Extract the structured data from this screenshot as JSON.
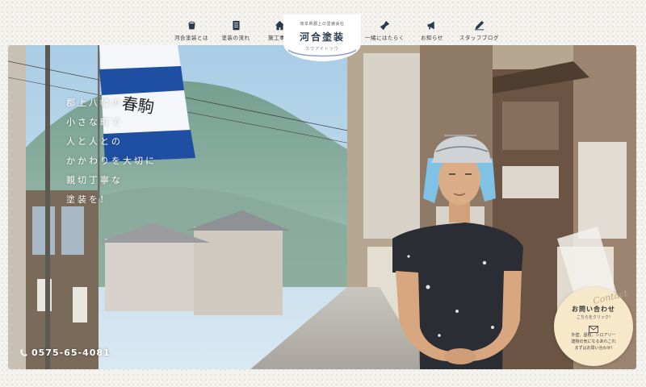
{
  "header": {
    "nav_left": [
      {
        "label": "河合塗装とは",
        "icon": "paint-bucket-icon"
      },
      {
        "label": "塗装の流れ",
        "icon": "document-icon"
      },
      {
        "label": "施工事例",
        "icon": "house-icon"
      }
    ],
    "logo": {
      "sub": "岐阜県郡上の塗装会社",
      "main": "河合塗装",
      "kana": "カワアイトソウ"
    },
    "nav_right": [
      {
        "label": "一緒にはたらく",
        "icon": "paint-brush-icon"
      },
      {
        "label": "お知らせ",
        "icon": "megaphone-icon"
      },
      {
        "label": "スタッフブログ",
        "icon": "pen-icon"
      }
    ]
  },
  "hero": {
    "catch_lines": [
      "郡上八幡の",
      "小さな町で",
      "人と人との",
      "かかわりを大切に",
      "親切丁寧な",
      "塗装を!"
    ],
    "banner_text": "春駒",
    "phone": "0575-65-4081"
  },
  "contact": {
    "script": "Contact",
    "title": "お問い合わせ",
    "sub": "こちらをクリック!",
    "text_lines": [
      "外壁、屋根、シロアリー",
      "建物の気になるあれこれ",
      "まずはお問い合わせ!"
    ]
  },
  "colors": {
    "brand_navy": "#2e3c52",
    "badge_bg": "#f6e8c8",
    "sky": "#b9d6ea"
  }
}
